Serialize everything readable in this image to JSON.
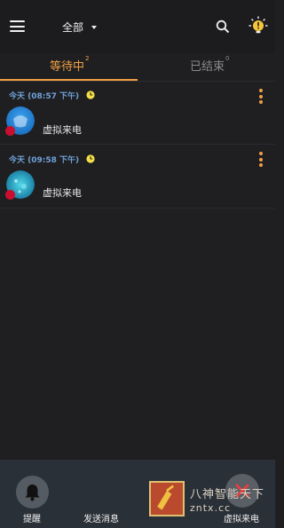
{
  "header": {
    "filter_label": "全部"
  },
  "tabs": [
    {
      "label": "等待中",
      "count": "2"
    },
    {
      "label": "已结束",
      "count": "0"
    }
  ],
  "items": [
    {
      "time": "今天 (08:57 下午)",
      "label": "虚拟来电"
    },
    {
      "time": "今天 (09:58 下午)",
      "label": "虚拟来电"
    }
  ],
  "bottom": {
    "remind_label": "提醒",
    "send_label": "发送消息",
    "call_label": "虚拟来电"
  },
  "watermark": {
    "line1": "八神智能天下",
    "line2": "zntx.cc"
  },
  "colors": {
    "accent": "#f0a045",
    "time_blue": "#6fa0d8",
    "background": "#1f1f21",
    "bottom_bar": "#2a3038"
  }
}
